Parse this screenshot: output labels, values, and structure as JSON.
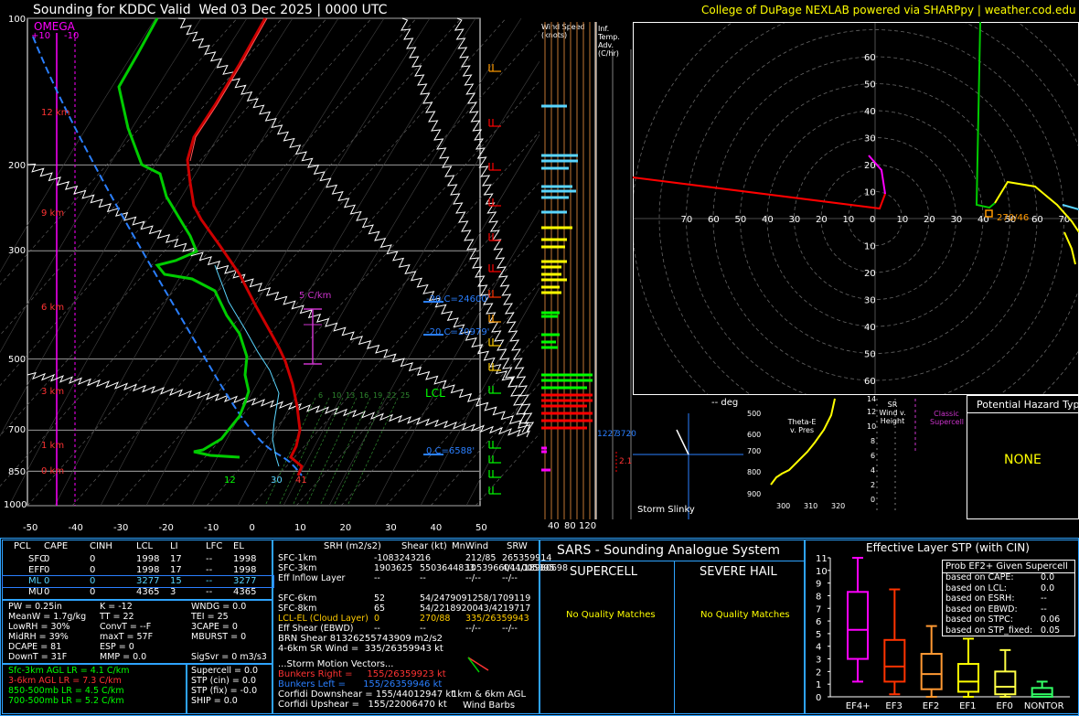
{
  "header": {
    "title": "Sounding for KDDC Valid  Wed 03 Dec 2025 | 0000 UTC",
    "credit": "College of DuPage NEXLAB powered via SHARPpy | weather.cod.edu"
  },
  "skewt": {
    "omega_label": "OMEGA",
    "omega_ticks": [
      "+10",
      "-10"
    ],
    "pressure_ticks": [
      "100",
      "200",
      "300",
      "500",
      "700",
      "850",
      "1000"
    ],
    "height_labels": [
      "12 km",
      "9 km",
      "6 km",
      "3 km",
      "1 km",
      "0 km"
    ],
    "temp_ticks": [
      "-50",
      "-40",
      "-30",
      "-20",
      "-10",
      "0",
      "10",
      "20",
      "30",
      "40",
      "50"
    ],
    "annotations": {
      "lcl": "LCL",
      "effective_layer": "5 C/km",
      "wb_zero": "0 C=6588'",
      "minus20": "-20 C=20979'",
      "minus30": "-30 C=24600'",
      "sfc_dewpoint": "12",
      "sfc_wetbulb": "30",
      "sfc_temp": "41",
      "mixing_ratios": [
        "6",
        "10",
        "13",
        "16",
        "19",
        "22",
        "25"
      ]
    },
    "colors": {
      "temperature": "#cc0000",
      "dewpoint": "#00cc00",
      "parcel": "#ffffff",
      "wetbulb": "#5ad6ff",
      "virtual": "#cc0000",
      "dry_adiabat": "#2a7fff"
    }
  },
  "wind_speed_panel": {
    "title": "Wind Speed (knots)",
    "ticks": [
      "40",
      "80",
      "120"
    ]
  },
  "temp_adv_panel": {
    "title": "Inf. Temp. Adv. (C/hr)",
    "labels": [
      "1227",
      "3720",
      "2.1"
    ]
  },
  "hodograph": {
    "rings_x": [
      "70",
      "60",
      "50",
      "40",
      "30",
      "20",
      "10",
      "0",
      "10",
      "20",
      "30",
      "40",
      "50",
      "60",
      "70"
    ],
    "rings_y": [
      "60",
      "50",
      "40",
      "30",
      "20",
      "10",
      "10",
      "20",
      "30",
      "40",
      "50",
      "60"
    ],
    "storm_motion_label": "270/46"
  },
  "storm_slinky": {
    "title": "-- deg",
    "label": "Storm Slinky"
  },
  "theta_e": {
    "title": "Theta-E v. Pres",
    "pressures": [
      "500",
      "600",
      "700",
      "800",
      "900"
    ],
    "thetas": [
      "300",
      "310",
      "320"
    ]
  },
  "sr_wind": {
    "title": "SR Wind v. Height",
    "heights": [
      "14",
      "12",
      "10",
      "8",
      "6",
      "4",
      "2",
      "0"
    ],
    "supercell_label": "Classic Supercell"
  },
  "hazard": {
    "title": "Potential Hazard Type",
    "value": "NONE"
  },
  "parcels": {
    "headers": [
      "PCL",
      "CAPE",
      "CINH",
      "LCL",
      "LI",
      "LFC",
      "EL"
    ],
    "rows": [
      [
        "SFC",
        "0",
        "0",
        "1998",
        "17",
        "--",
        "1998"
      ],
      [
        "EFF",
        "0",
        "0",
        "1998",
        "17",
        "--",
        "1998"
      ],
      [
        "ML",
        "0",
        "0",
        "3277",
        "15",
        "--",
        "3277"
      ],
      [
        "MU",
        "0",
        "0",
        "4365",
        "3",
        "--",
        "4365"
      ]
    ]
  },
  "indices": {
    "col1": [
      "PW = 0.25in",
      "MeanW = 1.7g/kg",
      "LowRH = 30%",
      "MidRH = 39%",
      "DCAPE = 81",
      "DownT = 31F"
    ],
    "col2": [
      "K = -12",
      "TT = 22",
      "ConvT = --F",
      "maxT = 57F",
      "ESP = 0",
      "MMP = 0.0"
    ],
    "col3": [
      "WNDG = 0.0",
      "TEI = 25",
      "3CAPE = 0",
      "MBURST = 0",
      "",
      "SigSvr = 0 m3/s3"
    ]
  },
  "lapse_rates": [
    "Sfc-3km AGL LR = 4.1 C/km",
    "3-6km AGL LR = 7.3 C/km",
    "850-500mb LR = 4.5 C/km",
    "700-500mb LR = 5.2 C/km"
  ],
  "composites": [
    "Supercell = 0.0",
    "STP (cin) = 0.0",
    "STP (fix) = -0.0",
    "SHIP = 0.0"
  ],
  "kinematics": {
    "headers": [
      "SRH (m2/s2)",
      "Shear (kt)",
      "MnWind",
      "SRW"
    ],
    "rows": [
      [
        "SFC-1km",
        "-10832432",
        "16",
        "212/85",
        "265359914"
      ],
      [
        "SFC-3km",
        "1903625",
        "5503644833",
        "1053966044/18980698",
        "4/11005395"
      ],
      [
        "Eff Inflow Layer",
        "--",
        "--",
        "--/--",
        "--/--"
      ],
      [
        "",
        "",
        "",
        "",
        ""
      ],
      [
        "SFC-6km",
        "52",
        "54/2479091258/1709119",
        "",
        ""
      ],
      [
        "SFC-8km",
        "65",
        "54/2218920043/4219717",
        "",
        ""
      ],
      [
        "LCL-EL (Cloud Layer)",
        "0",
        "270/88",
        "335/26359943",
        ""
      ],
      [
        "Eff Shear (EBWD)",
        "--",
        "--",
        "--/--",
        "--/--"
      ]
    ],
    "brn_shear": "BRN Shear 81326255743909 m2/s2",
    "sr_wind_4_6": "4-6km SR Wind =  335/26359943 kt",
    "storm_motion_title": "...Storm Motion Vectors...",
    "bunkers_right": "Bunkers Right =     155/26359923 kt",
    "bunkers_left": "Bunkers Left =      155/26359946 kt",
    "corfidi_down": "Corfidi Downshear = 155/44012947 kt",
    "corfidi_up": "Corfidi Upshear =   155/22006470 kt",
    "barbs_label": "1km & 6km AGL\nWind Barbs"
  },
  "sars": {
    "title": "SARS - Sounding Analogue System",
    "supercell_title": "SUPERCELL",
    "hail_title": "SEVERE HAIL",
    "supercell_result": "No Quality Matches",
    "hail_result": "No Quality Matches"
  },
  "stp_chart": {
    "title": "Effective Layer STP (with CIN)",
    "prob_title": "Prob EF2+ Given Supercell",
    "prob_rows": [
      [
        "based on CAPE:",
        "0.0"
      ],
      [
        "based on LCL:",
        "0.0"
      ],
      [
        "based on ESRH:",
        "--"
      ],
      [
        "based on EBWD:",
        "--"
      ],
      [
        "based on STPC:",
        "0.06"
      ],
      [
        "based on STP_fixed:",
        "0.05"
      ]
    ]
  },
  "chart_data": {
    "type": "box",
    "title": "Effective Layer STP (with CIN)",
    "categories": [
      "EF4+",
      "EF3",
      "EF2",
      "EF1",
      "EF0",
      "NONTOR"
    ],
    "ylim": [
      0,
      11
    ],
    "y_ticks": [
      "0",
      "1",
      "2",
      "3",
      "4",
      "5",
      "6",
      "7",
      "8",
      "9",
      "10",
      "11"
    ],
    "colors": [
      "#ff00ff",
      "#ff3300",
      "#ff9933",
      "#ffff00",
      "#ffff44",
      "#33ff66"
    ],
    "boxes": [
      {
        "whisker_low": 1.2,
        "q1": 3.0,
        "median": 5.3,
        "q3": 8.3,
        "whisker_high": 11.0
      },
      {
        "whisker_low": 0.2,
        "q1": 1.2,
        "median": 2.4,
        "q3": 4.5,
        "whisker_high": 8.5
      },
      {
        "whisker_low": 0.0,
        "q1": 0.6,
        "median": 1.8,
        "q3": 3.4,
        "whisker_high": 5.6
      },
      {
        "whisker_low": 0.0,
        "q1": 0.4,
        "median": 1.2,
        "q3": 2.6,
        "whisker_high": 4.6
      },
      {
        "whisker_low": 0.0,
        "q1": 0.2,
        "median": 0.8,
        "q3": 2.0,
        "whisker_high": 3.7
      },
      {
        "whisker_low": 0.0,
        "q1": 0.0,
        "median": 0.2,
        "q3": 0.7,
        "whisker_high": 1.2
      }
    ]
  }
}
